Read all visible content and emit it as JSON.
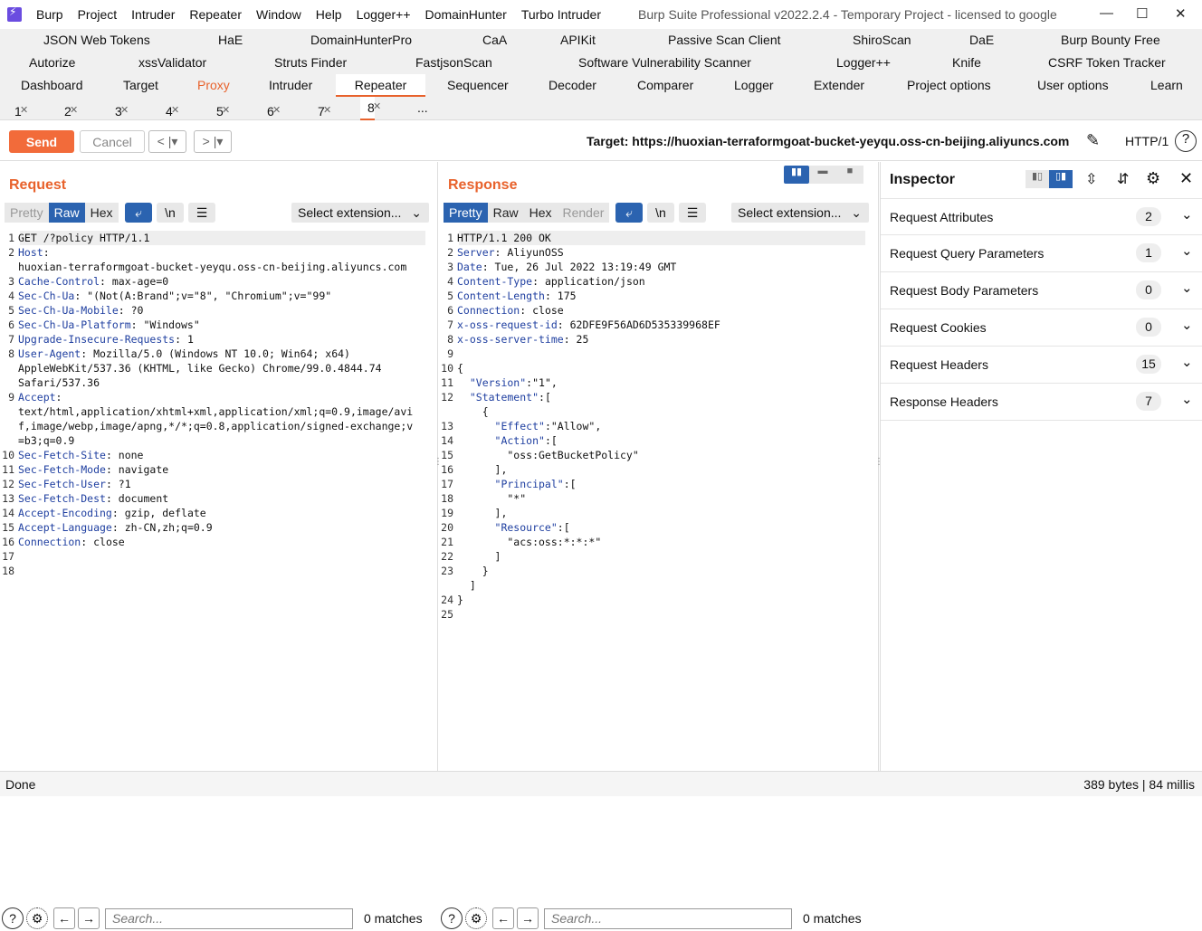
{
  "window": {
    "menu": [
      "Burp",
      "Project",
      "Intruder",
      "Repeater",
      "Window",
      "Help",
      "Logger++",
      "DomainHunter",
      "Turbo Intruder"
    ],
    "title": "Burp Suite Professional v2022.2.4 - Temporary Project - licensed to google"
  },
  "ext_tabs_row1": [
    "JSON Web Tokens",
    "HaE",
    "DomainHunterPro",
    "CaA",
    "APIKit",
    "Passive Scan Client",
    "ShiroScan",
    "DaE",
    "Burp Bounty Free"
  ],
  "ext_tabs_row2": [
    "Autorize",
    "xssValidator",
    "Struts Finder",
    "FastjsonScan",
    "Software Vulnerability Scanner",
    "Logger++",
    "Knife",
    "CSRF Token Tracker"
  ],
  "main_tabs": [
    "Dashboard",
    "Target",
    "Proxy",
    "Intruder",
    "Repeater",
    "Sequencer",
    "Decoder",
    "Comparer",
    "Logger",
    "Extender",
    "Project options",
    "User options",
    "Learn"
  ],
  "repeater_tabs": [
    "1",
    "2",
    "3",
    "4",
    "5",
    "6",
    "7",
    "8",
    "..."
  ],
  "toolbar": {
    "send": "Send",
    "cancel": "Cancel",
    "target_label": "Target: https://huoxian-terraformgoat-bucket-yeyqu.oss-cn-beijing.aliyuncs.com",
    "http_version": "HTTP/1"
  },
  "request": {
    "title": "Request",
    "formats": [
      "Pretty",
      "Raw",
      "Hex"
    ],
    "newline_toggle": "\\n",
    "select_extension": "Select extension...",
    "lines": [
      {
        "n": "1",
        "k": "",
        "v": "GET /?policy HTTP/1.1"
      },
      {
        "n": "2",
        "k": "Host",
        "v": ":"
      },
      {
        "n": "",
        "k": "",
        "v": "huoxian-terraformgoat-bucket-yeyqu.oss-cn-beijing.aliyuncs.com"
      },
      {
        "n": "3",
        "k": "Cache-Control",
        "v": ": max-age=0"
      },
      {
        "n": "4",
        "k": "Sec-Ch-Ua",
        "v": ": \"(Not(A:Brand\";v=\"8\", \"Chromium\";v=\"99\""
      },
      {
        "n": "5",
        "k": "Sec-Ch-Ua-Mobile",
        "v": ": ?0"
      },
      {
        "n": "6",
        "k": "Sec-Ch-Ua-Platform",
        "v": ": \"Windows\""
      },
      {
        "n": "7",
        "k": "Upgrade-Insecure-Requests",
        "v": ": 1"
      },
      {
        "n": "8",
        "k": "User-Agent",
        "v": ": Mozilla/5.0 (Windows NT 10.0; Win64; x64)"
      },
      {
        "n": "",
        "k": "",
        "v": "AppleWebKit/537.36 (KHTML, like Gecko) Chrome/99.0.4844.74"
      },
      {
        "n": "",
        "k": "",
        "v": "Safari/537.36"
      },
      {
        "n": "9",
        "k": "Accept",
        "v": ":"
      },
      {
        "n": "",
        "k": "",
        "v": "text/html,application/xhtml+xml,application/xml;q=0.9,image/avi"
      },
      {
        "n": "",
        "k": "",
        "v": "f,image/webp,image/apng,*/*;q=0.8,application/signed-exchange;v"
      },
      {
        "n": "",
        "k": "",
        "v": "=b3;q=0.9"
      },
      {
        "n": "10",
        "k": "Sec-Fetch-Site",
        "v": ": none"
      },
      {
        "n": "11",
        "k": "Sec-Fetch-Mode",
        "v": ": navigate"
      },
      {
        "n": "12",
        "k": "Sec-Fetch-User",
        "v": ": ?1"
      },
      {
        "n": "13",
        "k": "Sec-Fetch-Dest",
        "v": ": document"
      },
      {
        "n": "14",
        "k": "Accept-Encoding",
        "v": ": gzip, deflate"
      },
      {
        "n": "15",
        "k": "Accept-Language",
        "v": ": zh-CN,zh;q=0.9"
      },
      {
        "n": "16",
        "k": "Connection",
        "v": ": close"
      },
      {
        "n": "17",
        "k": "",
        "v": ""
      },
      {
        "n": "18",
        "k": "",
        "v": ""
      }
    ],
    "search_placeholder": "Search...",
    "matches": "0 matches"
  },
  "response": {
    "title": "Response",
    "formats": [
      "Pretty",
      "Raw",
      "Hex",
      "Render"
    ],
    "newline_toggle": "\\n",
    "select_extension": "Select extension...",
    "lines": [
      {
        "n": "1",
        "k": "",
        "v": "HTTP/1.1 200 OK"
      },
      {
        "n": "2",
        "k": "Server",
        "v": ": AliyunOSS"
      },
      {
        "n": "3",
        "k": "Date",
        "v": ": Tue, 26 Jul 2022 13:19:49 GMT"
      },
      {
        "n": "4",
        "k": "Content-Type",
        "v": ": application/json"
      },
      {
        "n": "5",
        "k": "Content-Length",
        "v": ": 175"
      },
      {
        "n": "6",
        "k": "Connection",
        "v": ": close"
      },
      {
        "n": "7",
        "k": "x-oss-request-id",
        "v": ": 62DFE9F56AD6D535339968EF"
      },
      {
        "n": "8",
        "k": "x-oss-server-time",
        "v": ": 25"
      },
      {
        "n": "9",
        "k": "",
        "v": ""
      },
      {
        "n": "10",
        "k": "",
        "v": "{"
      },
      {
        "n": "11",
        "k": "  \"Version\"",
        "v": ":\"1\","
      },
      {
        "n": "12",
        "k": "  \"Statement\"",
        "v": ":["
      },
      {
        "n": "",
        "k": "",
        "v": "    {"
      },
      {
        "n": "13",
        "k": "      \"Effect\"",
        "v": ":\"Allow\","
      },
      {
        "n": "14",
        "k": "      \"Action\"",
        "v": ":["
      },
      {
        "n": "15",
        "k": "",
        "v": "        \"oss:GetBucketPolicy\""
      },
      {
        "n": "16",
        "k": "",
        "v": "      ],"
      },
      {
        "n": "17",
        "k": "      \"Principal\"",
        "v": ":["
      },
      {
        "n": "18",
        "k": "",
        "v": "        \"*\""
      },
      {
        "n": "19",
        "k": "",
        "v": "      ],"
      },
      {
        "n": "20",
        "k": "      \"Resource\"",
        "v": ":["
      },
      {
        "n": "21",
        "k": "",
        "v": "        \"acs:oss:*:*:*\""
      },
      {
        "n": "22",
        "k": "",
        "v": "      ]"
      },
      {
        "n": "23",
        "k": "",
        "v": "    }"
      },
      {
        "n": "",
        "k": "",
        "v": "  ]"
      },
      {
        "n": "24",
        "k": "",
        "v": "}"
      },
      {
        "n": "25",
        "k": "",
        "v": ""
      }
    ],
    "search_placeholder": "Search...",
    "matches": "0 matches"
  },
  "inspector": {
    "title": "Inspector",
    "sections": [
      {
        "label": "Request Attributes",
        "count": "2"
      },
      {
        "label": "Request Query Parameters",
        "count": "1"
      },
      {
        "label": "Request Body Parameters",
        "count": "0"
      },
      {
        "label": "Request Cookies",
        "count": "0"
      },
      {
        "label": "Request Headers",
        "count": "15"
      },
      {
        "label": "Response Headers",
        "count": "7"
      }
    ]
  },
  "status": {
    "left": "Done",
    "right": "389 bytes | 84 millis"
  },
  "colors": {
    "accent": "#e8622c",
    "send": "#f26b3a",
    "selected": "#2b63b0"
  }
}
